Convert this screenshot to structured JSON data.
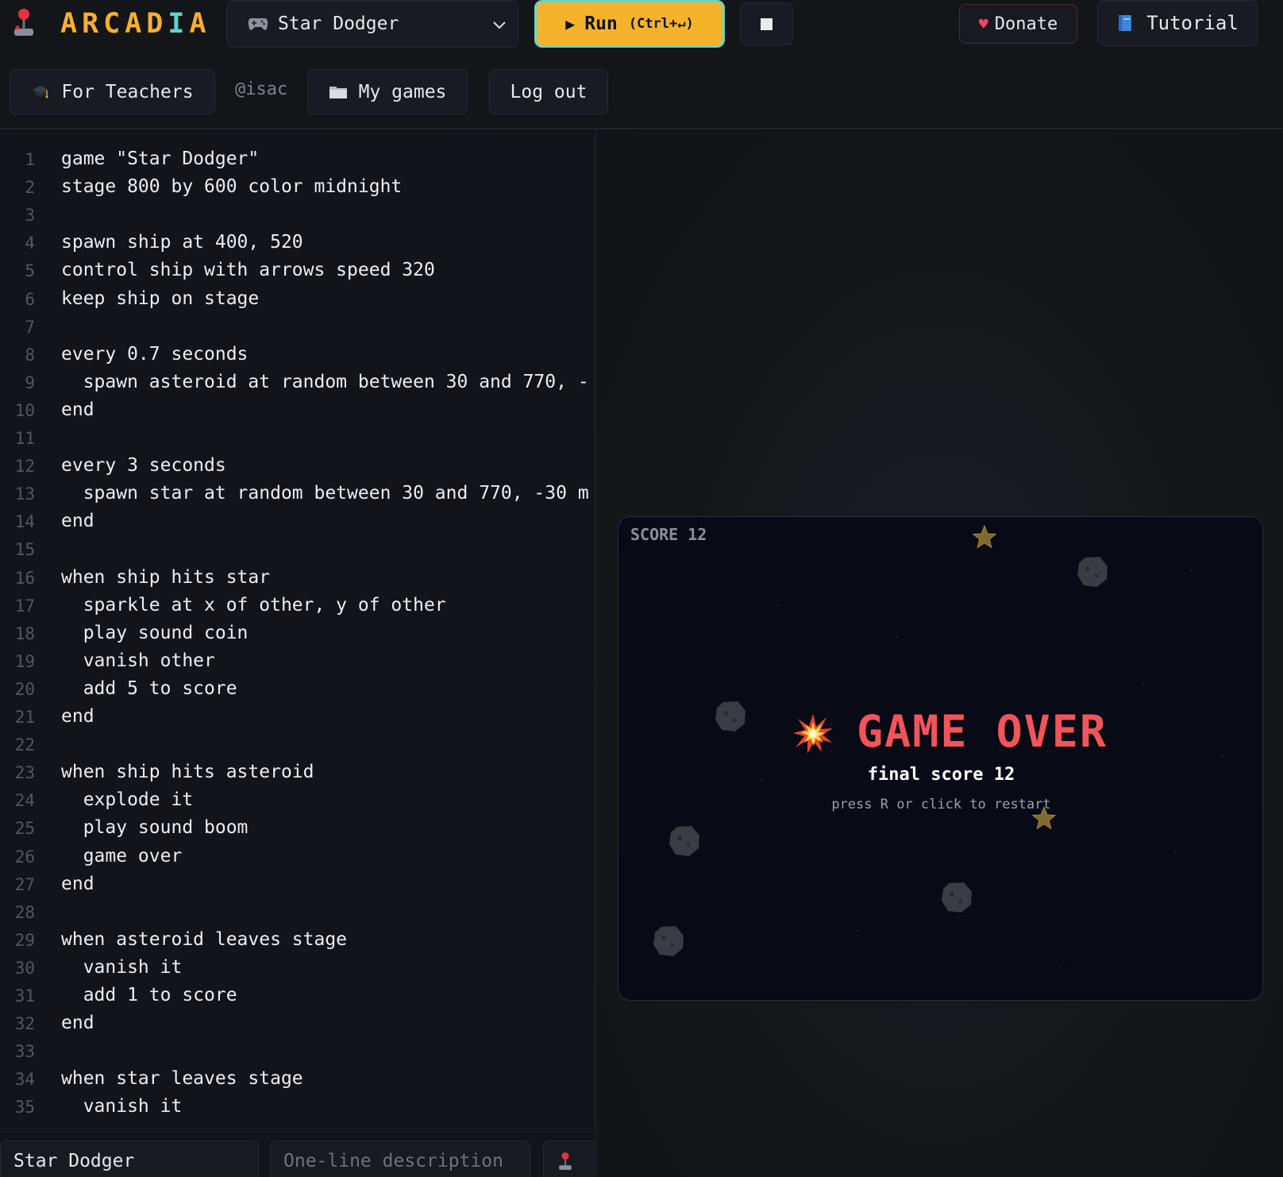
{
  "header": {
    "logo_text_a": "ARCAD",
    "logo_text_i": "I",
    "logo_text_b": "A",
    "game_select": "Star Dodger",
    "run_label": "Run",
    "run_shortcut": "(Ctrl+↵)",
    "donate_label": "Donate",
    "tutorial_label": "Tutorial",
    "teachers_label": "For Teachers",
    "username": "@isac",
    "my_games_label": "My games",
    "logout_label": "Log out"
  },
  "icons": {
    "logo": "joystick-icon",
    "game_select": "gamepad-icon",
    "dropdown": "chevron-down-icon",
    "run": "play-icon",
    "stop": "stop-icon",
    "donate": "heart-icon",
    "tutorial": "book-icon",
    "teachers": "graduation-cap-icon",
    "my_games": "folder-icon"
  },
  "colors": {
    "accent": "#f5b32c",
    "teal": "#65d8c5",
    "game_over": "#f3545a",
    "background": "#111318"
  },
  "editor": {
    "lines": [
      "game \"Star Dodger\"",
      "stage 800 by 600 color midnight",
      "",
      "spawn ship at 400, 520",
      "control ship with arrows speed 320",
      "keep ship on stage",
      "",
      "every 0.7 seconds",
      "  spawn asteroid at random between 30 and 770, -",
      "end",
      "",
      "every 3 seconds",
      "  spawn star at random between 30 and 770, -30 m",
      "end",
      "",
      "when ship hits star",
      "  sparkle at x of other, y of other",
      "  play sound coin",
      "  vanish other",
      "  add 5 to score",
      "end",
      "",
      "when ship hits asteroid",
      "  explode it",
      "  play sound boom",
      "  game over",
      "end",
      "",
      "when asteroid leaves stage",
      "  vanish it",
      "  add 1 to score",
      "end",
      "",
      "when star leaves stage",
      "  vanish it"
    ]
  },
  "footer": {
    "title_value": "Star Dodger",
    "description_placeholder": "One-line description"
  },
  "game": {
    "score_label": "SCORE 12",
    "game_over_title": "GAME OVER",
    "final_score": "final score 12",
    "restart_hint": "press R or click to restart"
  }
}
